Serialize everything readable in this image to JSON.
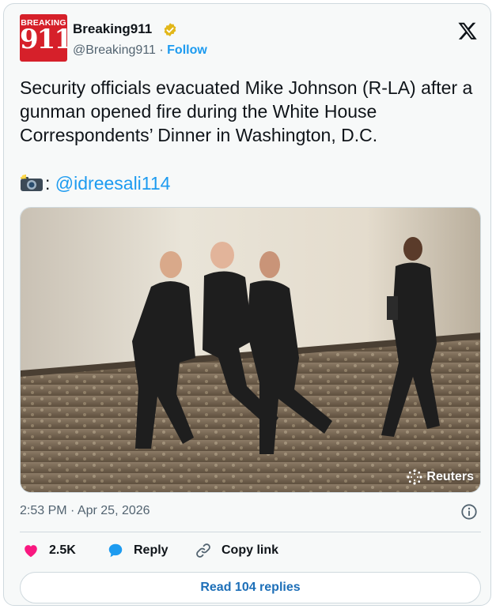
{
  "author": {
    "avatar_top_text": "BREAKING",
    "avatar_number": "911",
    "name": "Breaking911",
    "handle": "@Breaking911",
    "separator": "·",
    "follow_label": "Follow"
  },
  "tweet": {
    "text": "Security officials evacuated Mike Johnson (R-LA) after a gunman opened fire during the White House Correspondents’ Dinner in Washington, D.C.",
    "credit_sep": ":",
    "credit_link": "@idreesali114"
  },
  "photo": {
    "watermark": "Reuters"
  },
  "timestamp": "2:53 PM · Apr 25, 2026",
  "actions": {
    "likes": "2.5K",
    "reply_label": "Reply",
    "copy_label": "Copy link"
  },
  "read_replies_label": "Read 104 replies",
  "colors": {
    "accent": "#1d9bf0",
    "like": "#f91880",
    "brand": "#d6202a",
    "verified": "#e2b719"
  }
}
